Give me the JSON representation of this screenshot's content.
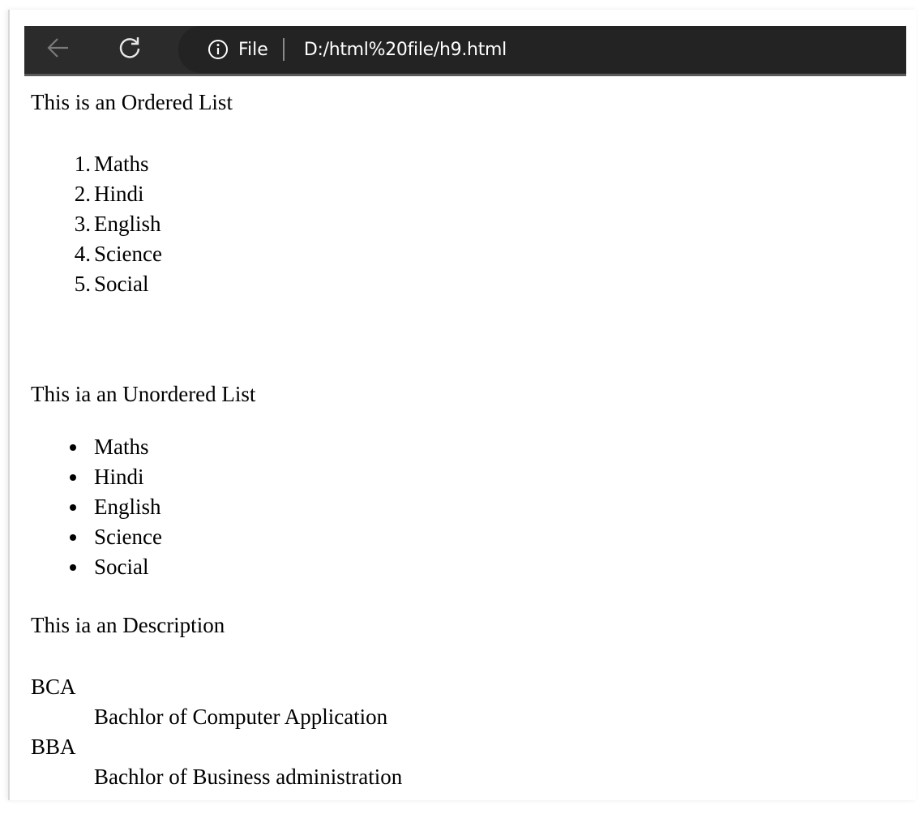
{
  "browser": {
    "address_prefix": "File",
    "url": "D:/html%20file/h9.html"
  },
  "page": {
    "ordered_heading": "This is an Ordered List",
    "ordered_items": [
      {
        "num": "1.",
        "label": "Maths"
      },
      {
        "num": "2.",
        "label": "Hindi"
      },
      {
        "num": "3.",
        "label": "English"
      },
      {
        "num": "4.",
        "label": "Science"
      },
      {
        "num": "5.",
        "label": "Social"
      }
    ],
    "unordered_heading": "This ia an Unordered List",
    "unordered_items": [
      "Maths",
      "Hindi",
      "English",
      "Science",
      "Social"
    ],
    "description_heading": "This ia an Description",
    "descriptions": [
      {
        "term": "BCA",
        "desc": "Bachlor of Computer Application"
      },
      {
        "term": "BBA",
        "desc": "Bachlor of Business administration"
      }
    ]
  },
  "icons": {
    "back": "arrow-left-icon",
    "refresh": "refresh-icon",
    "info": "info-icon"
  },
  "colors": {
    "toolbar_bg": "#2b2b2b",
    "address_bg": "#232323",
    "text": "#000000"
  }
}
